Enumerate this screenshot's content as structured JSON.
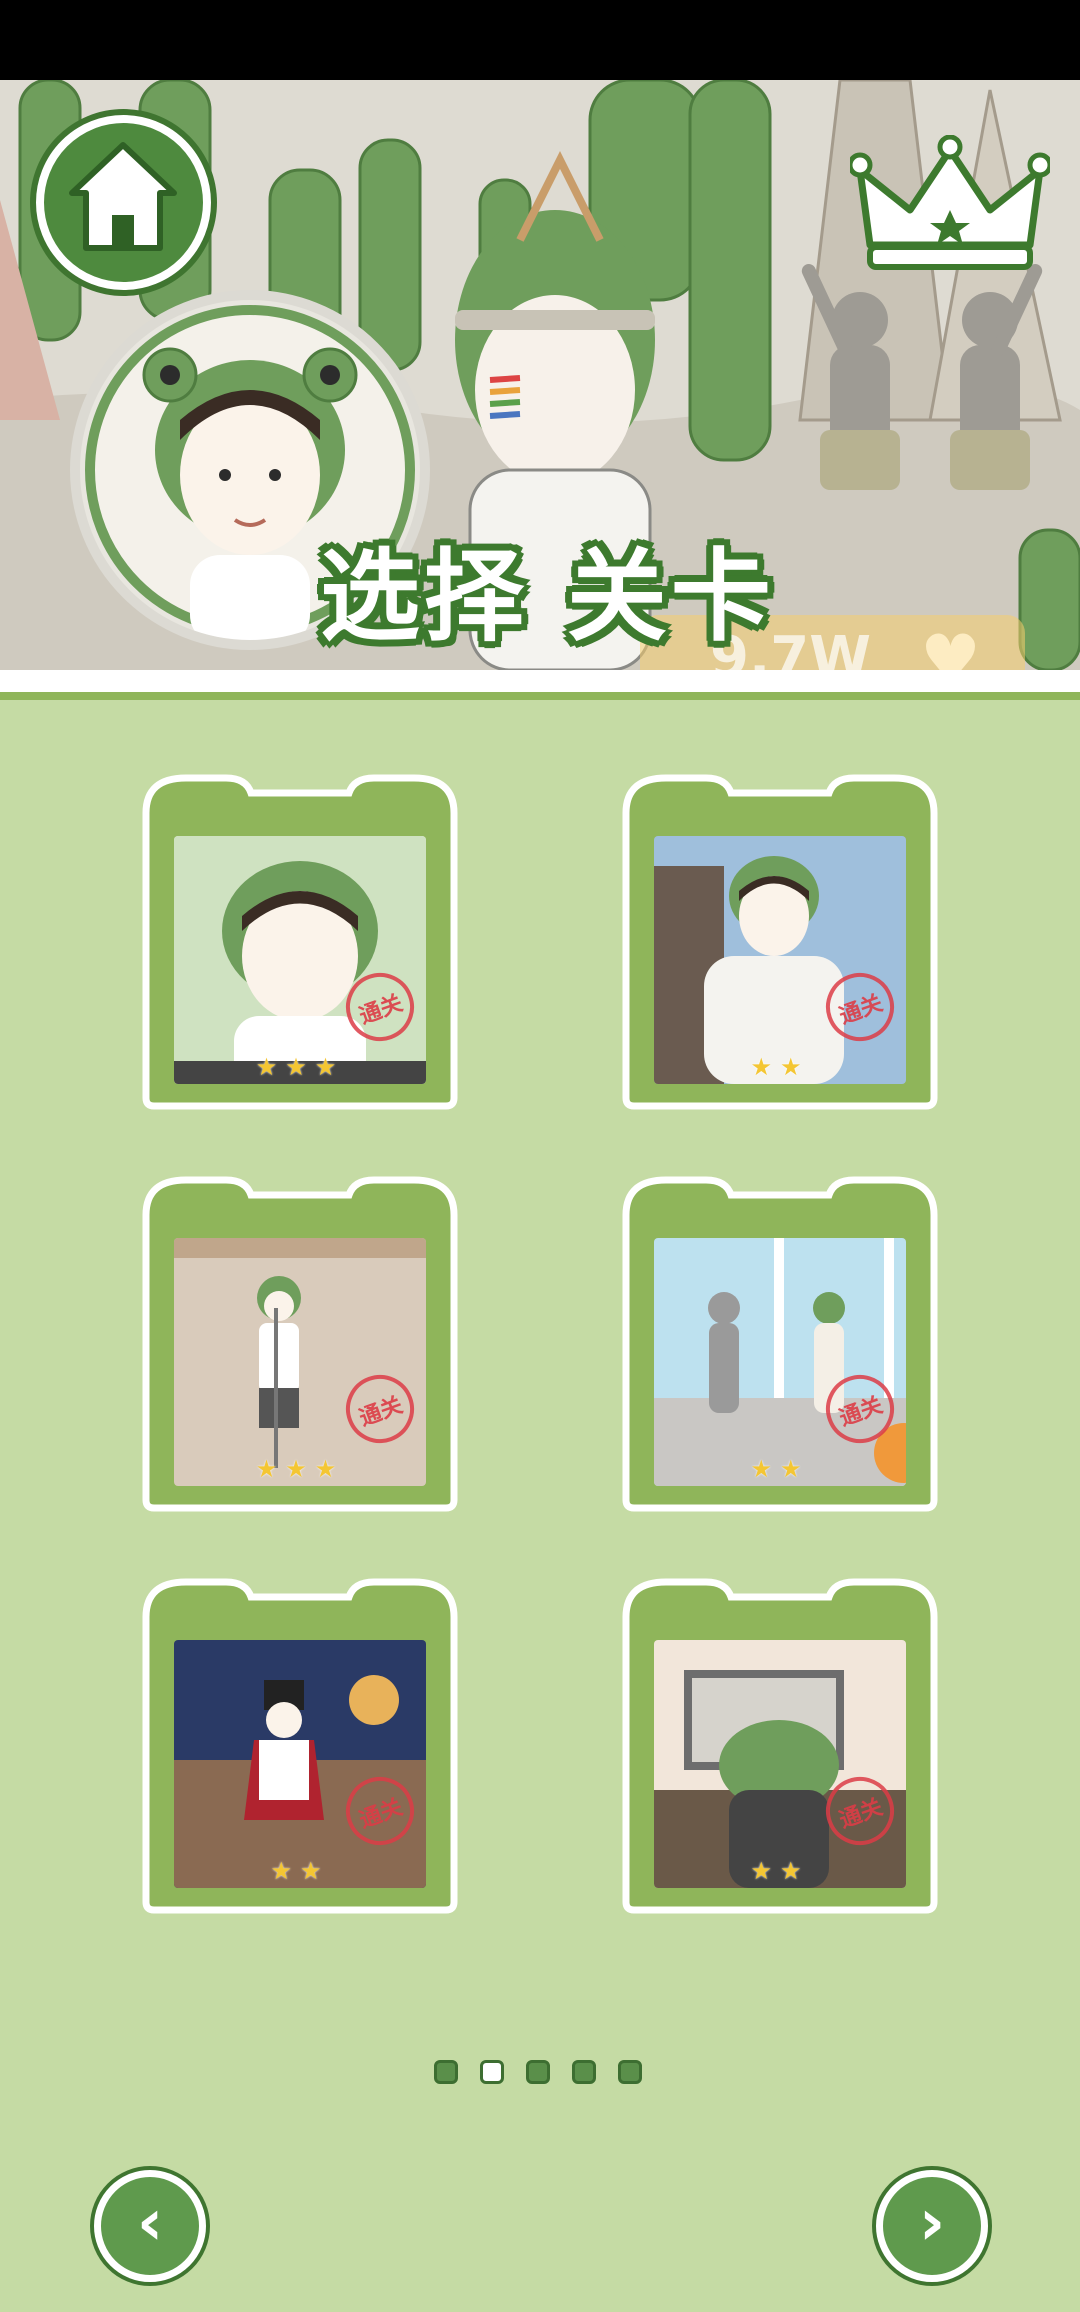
{
  "header": {
    "title": "选择 关卡",
    "hearts_text": "9.7W",
    "heart_icon": "heart-icon"
  },
  "levels": [
    {
      "stamp": "通关",
      "stars": "★★★"
    },
    {
      "stamp": "通关",
      "stars": "★★"
    },
    {
      "stamp": "通关",
      "stars": "★★★"
    },
    {
      "stamp": "通关",
      "stars": "★★"
    },
    {
      "stamp": "通关",
      "stars": "★★"
    },
    {
      "stamp": "通关",
      "stars": "★★"
    }
  ],
  "pagination": {
    "current_page": 2,
    "total_pages": 5
  },
  "colors": {
    "background": "#c5dba4",
    "frame_green": "#8fb55a",
    "dark_green": "#3d7a2e",
    "stamp_red": "#dc3c46",
    "star_yellow": "#f4c633"
  }
}
